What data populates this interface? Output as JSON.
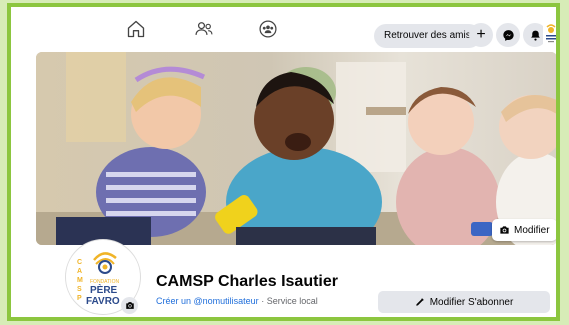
{
  "nav": {
    "icons": [
      "home-icon",
      "friends-icon",
      "groups-icon"
    ],
    "find_friends_label": "Retrouver des amis",
    "plus_symbol": "+",
    "messenger_icon": "messenger-icon",
    "notifications_icon": "bell-icon"
  },
  "cover": {
    "modify_label": "Modifier"
  },
  "profile": {
    "logo_letters": [
      "C",
      "A",
      "M",
      "S",
      "P"
    ],
    "logo_text": [
      "FONDATION",
      "PÈRE",
      "FAVRO"
    ],
    "name": "CAMSP Charles Isautier",
    "create_username": "Créer un @nomutilisateur",
    "separator": "·",
    "category": "Service local",
    "action_label": "Modifier S'abonner"
  },
  "colors": {
    "page_background": "#d7ecb7",
    "frame_border": "#8cc63f",
    "link": "#216fdb",
    "button_grey": "#e4e6eb"
  }
}
